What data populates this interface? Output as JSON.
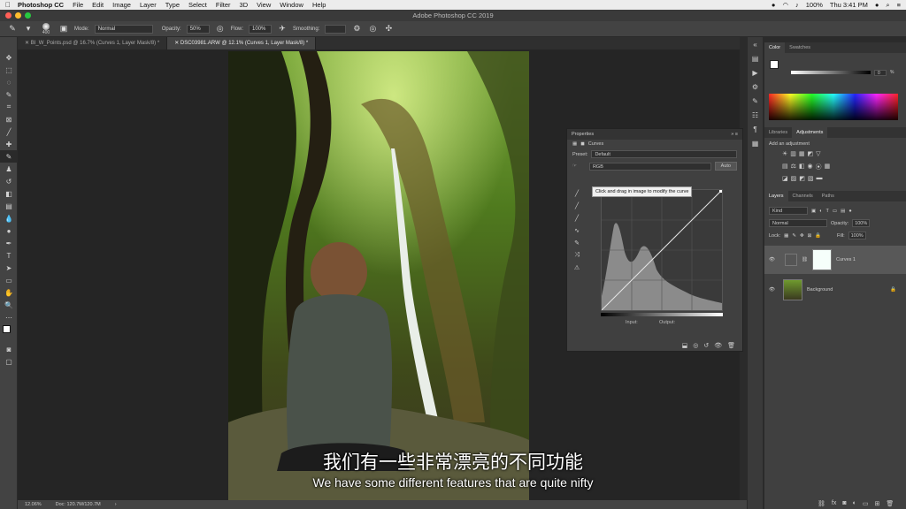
{
  "menubar": {
    "app_name": "Photoshop CC",
    "items": [
      "File",
      "Edit",
      "Image",
      "Layer",
      "Type",
      "Select",
      "Filter",
      "3D",
      "View",
      "Window",
      "Help"
    ],
    "battery": "100%",
    "clock": "Thu 3:41 PM"
  },
  "window_title": "Adobe Photoshop CC 2019",
  "options_bar": {
    "brush_size": "400",
    "mode_label": "Mode:",
    "mode_value": "Normal",
    "opacity_label": "Opacity:",
    "opacity_value": "50%",
    "flow_label": "Flow:",
    "flow_value": "100%",
    "smoothing_label": "Smoothing:"
  },
  "document_tabs": [
    {
      "label": "BI_W_Points.psd @ 16.7% (Curves 1, Layer Mask/8) *",
      "active": false
    },
    {
      "label": "DSC03981.ARW @ 12.1% (Curves 1, Layer Mask/8) *",
      "active": true
    }
  ],
  "status_bar": {
    "zoom": "12.06%",
    "doc_info": "Doc: 120.7M/120.7M",
    "arrow": "›"
  },
  "properties_panel": {
    "title": "Properties",
    "layer_type": "Curves",
    "preset_label": "Preset:",
    "preset_value": "Default",
    "channel_value": "RGB",
    "auto_label": "Auto",
    "tooltip": "Click and drag in image to modify the curve",
    "input_label": "Input:",
    "output_label": "Output:"
  },
  "color_panel": {
    "tabs": [
      "Color",
      "Swatches"
    ],
    "value": "0",
    "unit": "%"
  },
  "adjustments_panel": {
    "tabs": [
      "Libraries",
      "Adjustments"
    ],
    "add_label": "Add an adjustment"
  },
  "layers_panel": {
    "tabs": [
      "Layers",
      "Channels",
      "Paths"
    ],
    "filter_value": "Kind",
    "blend_mode": "Normal",
    "opacity_label": "Opacity:",
    "opacity_value": "100%",
    "lock_label": "Lock:",
    "fill_label": "Fill:",
    "fill_value": "100%",
    "layers": [
      {
        "name": "Curves 1",
        "selected": true
      },
      {
        "name": "Background",
        "selected": false
      }
    ]
  },
  "subtitles": {
    "chinese": "我们有一些非常漂亮的不同功能",
    "english": "We have some different features that are quite nifty"
  },
  "colors": {
    "traffic_red": "#ff5f57",
    "traffic_yellow": "#febc2e",
    "traffic_green": "#28c840"
  }
}
